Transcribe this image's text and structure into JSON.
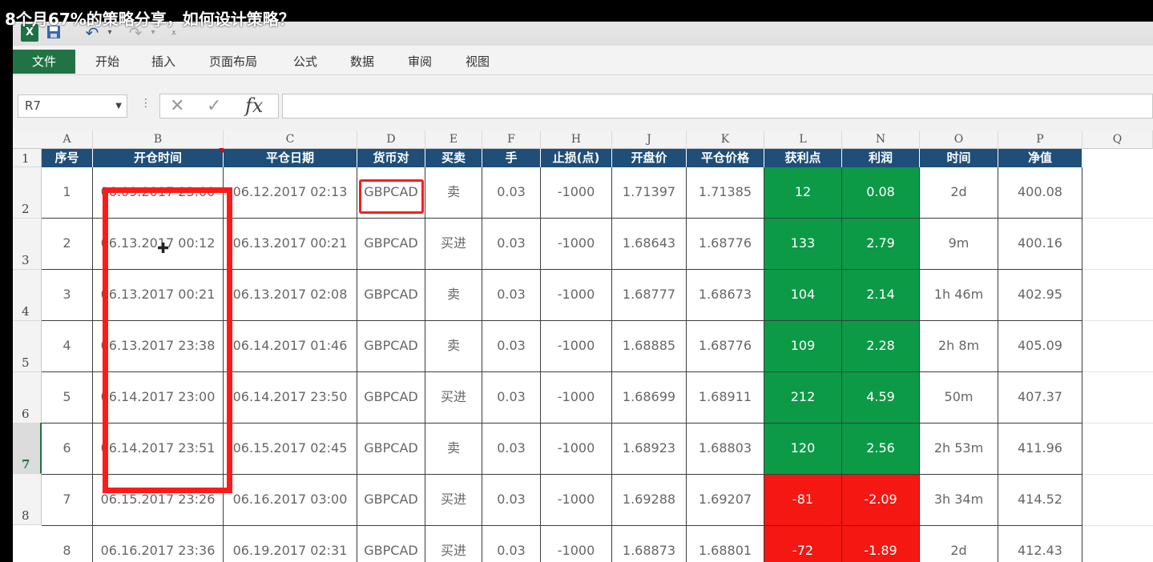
{
  "video_title": "8个月67%的策略分享，如何设计策略？",
  "quick_access": {
    "excel_icon": "excel-icon",
    "save_icon": "save-icon",
    "undo_icon": "undo-icon",
    "redo_icon": "redo-icon",
    "customize_icon": "customize-icon"
  },
  "ribbon_tabs": [
    {
      "label": "文件"
    },
    {
      "label": "开始"
    },
    {
      "label": "插入"
    },
    {
      "label": "页面布局"
    },
    {
      "label": "公式"
    },
    {
      "label": "数据"
    },
    {
      "label": "审阅"
    },
    {
      "label": "视图"
    }
  ],
  "name_box": {
    "value": "R7"
  },
  "formula_bar": {
    "cancel": "✕",
    "enter": "✓",
    "fx": "fx",
    "value": ""
  },
  "column_letters": [
    "A",
    "B",
    "C",
    "D",
    "E",
    "F",
    "H",
    "J",
    "K",
    "L",
    "N",
    "O",
    "P",
    "Q"
  ],
  "row_numbers": [
    "1",
    "2",
    "3",
    "4",
    "5",
    "6",
    "7",
    "8"
  ],
  "selected_row": "7",
  "table": {
    "headers": [
      "序号",
      "开仓时间",
      "平仓日期",
      "货币对",
      "买卖",
      "手",
      "止损(点)",
      "开盘价",
      "平仓价格",
      "获利点",
      "利润",
      "时间",
      "净值"
    ],
    "rows": [
      [
        "1",
        "06.09.2017 23:00",
        "06.12.2017 02:13",
        "GBPCAD",
        "卖",
        "0.03",
        "-1000",
        "1.71397",
        "1.71385",
        "12",
        "0.08",
        "2d",
        "400.08"
      ],
      [
        "2",
        "06.13.2017 00:12",
        "06.13.2017 00:21",
        "GBPCAD",
        "买进",
        "0.03",
        "-1000",
        "1.68643",
        "1.68776",
        "133",
        "2.79",
        "9m",
        "400.16"
      ],
      [
        "3",
        "06.13.2017 00:21",
        "06.13.2017 02:08",
        "GBPCAD",
        "卖",
        "0.03",
        "-1000",
        "1.68777",
        "1.68673",
        "104",
        "2.14",
        "1h 46m",
        "402.95"
      ],
      [
        "4",
        "06.13.2017 23:38",
        "06.14.2017 01:46",
        "GBPCAD",
        "卖",
        "0.03",
        "-1000",
        "1.68885",
        "1.68776",
        "109",
        "2.28",
        "2h 8m",
        "405.09"
      ],
      [
        "5",
        "06.14.2017 23:00",
        "06.14.2017 23:50",
        "GBPCAD",
        "买进",
        "0.03",
        "-1000",
        "1.68699",
        "1.68911",
        "212",
        "4.59",
        "50m",
        "407.37"
      ],
      [
        "6",
        "06.14.2017 23:51",
        "06.15.2017 02:45",
        "GBPCAD",
        "卖",
        "0.03",
        "-1000",
        "1.68923",
        "1.68803",
        "120",
        "2.56",
        "2h 53m",
        "411.96"
      ],
      [
        "7",
        "06.15.2017 23:26",
        "06.16.2017 03:00",
        "GBPCAD",
        "买进",
        "0.03",
        "-1000",
        "1.69288",
        "1.69207",
        "-81",
        "-2.09",
        "3h 34m",
        "414.52"
      ],
      [
        "8",
        "06.16.2017 23:36",
        "06.19.2017 02:31",
        "GBPCAD",
        "买进",
        "0.03",
        "-1000",
        "1.68873",
        "1.68801",
        "-72",
        "-1.89",
        "2d",
        "412.43"
      ]
    ]
  },
  "colors": {
    "header_fill": "#1f4e79",
    "profit_fill": "#0c9a47",
    "loss_fill": "#f41712",
    "annotation": "#ff1a1a",
    "excel_green": "#217346"
  }
}
